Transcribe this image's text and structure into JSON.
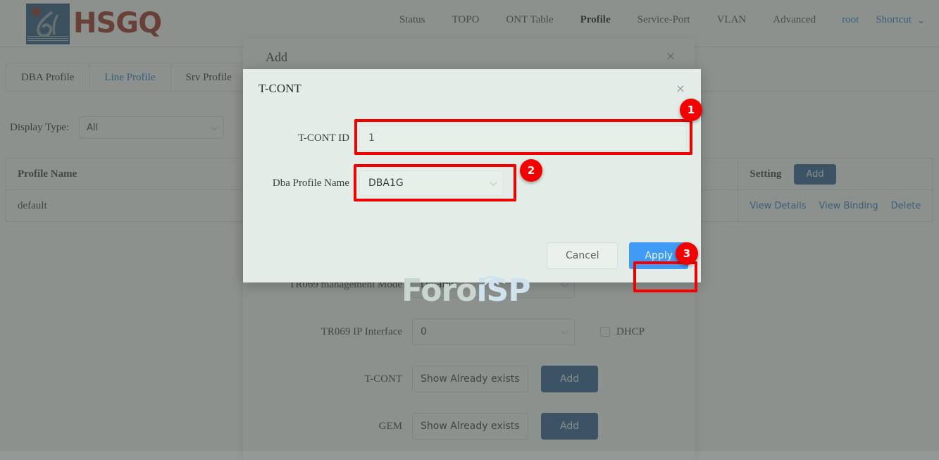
{
  "header": {
    "logo_text": "HSGQ",
    "nav_items": [
      {
        "label": "Status",
        "active": false
      },
      {
        "label": "TOPO",
        "active": false
      },
      {
        "label": "ONT Table",
        "active": false
      },
      {
        "label": "Profile",
        "active": true
      },
      {
        "label": "Service-Port",
        "active": false
      },
      {
        "label": "VLAN",
        "active": false
      },
      {
        "label": "Advanced",
        "active": false
      }
    ],
    "user": "root",
    "shortcut": "Shortcut",
    "caret": "⌄"
  },
  "tabs": [
    {
      "label": "DBA Profile",
      "active": false
    },
    {
      "label": "Line Profile",
      "active": true
    },
    {
      "label": "Srv Profile",
      "active": false
    }
  ],
  "filter": {
    "label": "Display Type:",
    "value": "All"
  },
  "table": {
    "header_profile_name": "Profile Name",
    "header_setting": "Setting",
    "add_label": "Add",
    "rows": [
      {
        "profile_name": "default",
        "actions": [
          "View Details",
          "View Binding",
          "Delete"
        ]
      }
    ]
  },
  "add_dialog": {
    "title": "Add",
    "close": "×",
    "fields": [
      {
        "label": "TR069 management Mode",
        "value": "Disable",
        "type": "select"
      },
      {
        "label": "TR069 IP Interface",
        "value": "0",
        "type": "select",
        "checkbox_label": "DHCP"
      },
      {
        "label": "T-CONT",
        "value": "Show Already exists",
        "type": "text",
        "button": "Add"
      },
      {
        "label": "GEM",
        "value": "Show Already exists",
        "type": "text",
        "button": "Add"
      }
    ]
  },
  "tcont_modal": {
    "title": "T-CONT",
    "close": "×",
    "tcont_id_label": "T-CONT ID",
    "tcont_id_value": "1",
    "dba_profile_label": "Dba Profile Name",
    "dba_profile_value": "DBA1G",
    "cancel_label": "Cancel",
    "apply_label": "Apply",
    "markers": [
      "1",
      "2",
      "3"
    ]
  },
  "watermark": {
    "part_a": "Foro",
    "part_b": "iSP"
  },
  "colors": {
    "accent_blue": "#2878c8",
    "apply_blue": "#3f9bf5",
    "add_blue": "#2a5d93",
    "marker_red": "#f40000",
    "logo_red": "#a32a1f",
    "logo_blue": "#2b5580",
    "modal_bg": "#e3ece7"
  }
}
